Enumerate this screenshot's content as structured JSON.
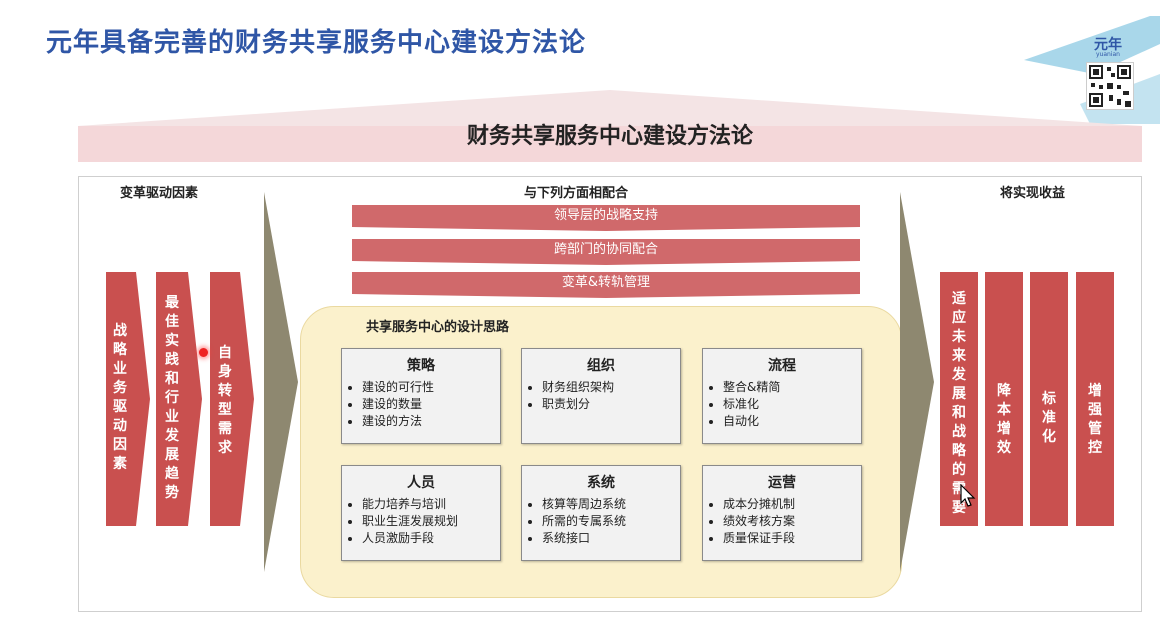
{
  "slide_title": "元年具备完善的财务共享服务中心建设方法论",
  "logo": {
    "text": "元年",
    "sub": "yuanian"
  },
  "roof_title": "财务共享服务中心建设方法论",
  "left_section": {
    "title": "变革驱动因素",
    "bars": [
      "战略业务驱动因素",
      "最佳实践和行业发展趋势",
      "自身转型需求"
    ]
  },
  "middle_section": {
    "title": "与下列方面相配合",
    "bands": [
      "领导层的战略支持",
      "跨部门的协同配合",
      "变革&转轨管理"
    ],
    "design": {
      "title": "共享服务中心的设计思路",
      "cards": [
        {
          "title": "策略",
          "items": [
            "建设的可行性",
            "建设的数量",
            "建设的方法"
          ]
        },
        {
          "title": "组织",
          "items": [
            "财务组织架构",
            "职责划分"
          ]
        },
        {
          "title": "流程",
          "items": [
            "整合&精简",
            "标准化",
            "自动化"
          ]
        },
        {
          "title": "人员",
          "items": [
            "能力培养与培训",
            "职业生涯发展规划",
            "人员激励手段"
          ]
        },
        {
          "title": "系统",
          "items": [
            "核算等周边系统",
            "所需的专属系统",
            "系统接口"
          ]
        },
        {
          "title": "运营",
          "items": [
            "成本分摊机制",
            "绩效考核方案",
            "质量保证手段"
          ]
        }
      ]
    }
  },
  "right_section": {
    "title": "将实现收益",
    "bars": [
      "适应未来发展和战略的需要",
      "降本增效",
      "标准化",
      "增强管控"
    ]
  },
  "colors": {
    "title_blue": "#2f56a6",
    "bar_red": "#c9504f",
    "band_red": "#d0696b",
    "panel_yellow": "#fbf1cc",
    "roof_pink": "#f4d7d9",
    "arrow_olive": "#8e8870"
  }
}
